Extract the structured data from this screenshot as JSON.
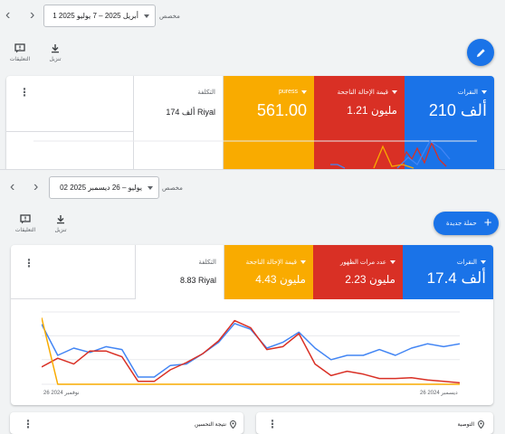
{
  "top": {
    "date_range": "1 أبريل 2025 – 7 يوليو 2025",
    "custom_label": "مخصص",
    "tools": [
      {
        "label": "التعليقات",
        "icon": "feedback-icon"
      },
      {
        "label": "تنزيل",
        "icon": "download-icon"
      }
    ],
    "metrics": [
      {
        "label": "النقرات",
        "value": "210 ألف",
        "color": "#1a73e8"
      },
      {
        "label": "قيمة الإحالة الناجحة",
        "value": "1.21 مليون",
        "color": "#d93025"
      },
      {
        "label": "puress",
        "value": "561.00",
        "color": "#f9ab00"
      },
      {
        "label": "التكلفة",
        "value": "174 ألف Riyal",
        "color": "#ffffff"
      }
    ]
  },
  "bottom": {
    "date_range": "02 يوليو – 26 ديسمبر 2025",
    "custom_label": "مخصص",
    "tools": [
      {
        "label": "التعليقات",
        "icon": "feedback-icon"
      },
      {
        "label": "تنزيل",
        "icon": "download-icon"
      }
    ],
    "new_campaign_label": "حملة جديدة",
    "metrics": [
      {
        "label": "النقرات",
        "value": "17.4 ألف",
        "color": "#1a73e8"
      },
      {
        "label": "عدد مرات الظهور",
        "value": "2.23 مليون",
        "color": "#d93025"
      },
      {
        "label": "قيمة الإحالة الناجحة",
        "value": "4.43 مليون",
        "color": "#f9ab00"
      },
      {
        "label": "التكلفة",
        "value": "8.83 Riyal",
        "color": "#ffffff"
      }
    ],
    "x_start_label": "26 نوفمبر 2024",
    "x_end_label": "26 ديسمبر 2024",
    "bottom_cards": [
      {
        "label": "نتيجة التحسين",
        "icon": "pin-icon"
      },
      {
        "label": "التوصية",
        "icon": "pin-icon"
      }
    ]
  },
  "chart_data": {
    "type": "line",
    "x_start": "26 نوفمبر 2024",
    "x_end": "26 ديسمبر 2024",
    "series": [
      {
        "values": [
          83,
          40,
          50,
          44,
          52,
          48,
          10,
          10,
          26,
          28,
          42,
          58,
          84,
          76,
          50,
          58,
          72,
          50,
          34,
          40,
          40,
          48,
          40,
          50,
          56,
          52,
          56
        ]
      },
      {
        "values": [
          24,
          36,
          28,
          46,
          46,
          38,
          4,
          4,
          20,
          30,
          42,
          60,
          88,
          78,
          48,
          52,
          70,
          28,
          12,
          18,
          14,
          8,
          8,
          9,
          6,
          4,
          2
        ]
      },
      {
        "values": [
          92,
          0,
          0,
          0,
          0,
          0,
          0,
          0,
          0,
          0,
          0,
          0,
          0,
          0,
          0,
          0,
          0,
          0,
          0,
          0,
          0,
          0,
          0,
          0,
          0,
          0,
          0
        ]
      }
    ],
    "colors": [
      "#4285f4",
      "#d93025",
      "#f9ab00"
    ],
    "grid": true
  }
}
